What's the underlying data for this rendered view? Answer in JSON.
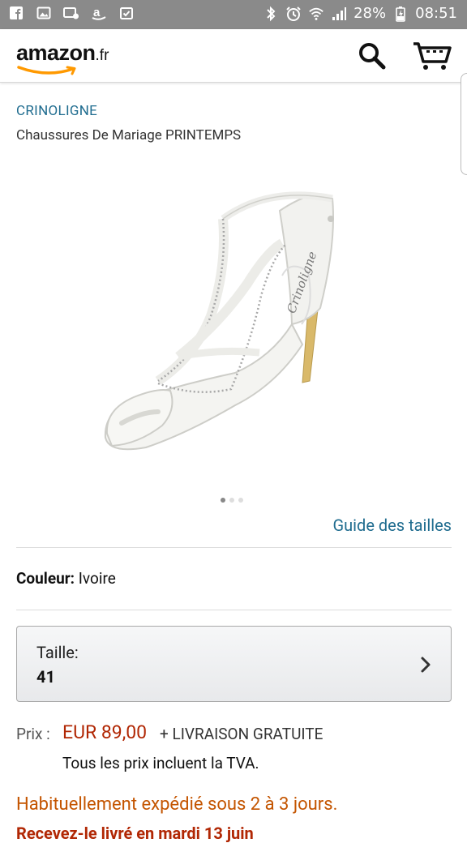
{
  "status_bar": {
    "icons_left": [
      "facebook-icon",
      "gallery-icon",
      "photo-notification-icon",
      "amazon-app-icon",
      "clipboard-check-icon"
    ],
    "battery": "28%",
    "time": "08:51"
  },
  "header": {
    "logo_text": "amazon",
    "logo_tld": ".fr",
    "accent_color": "#ff9900"
  },
  "product": {
    "brand": "CRINOLIGNE",
    "title": "Chaussures De Mariage PRINTEMPS",
    "image_label": "white-bridal-sandal-image",
    "image_count": 3,
    "active_image_index": 0,
    "size_guide_label": "Guide des tailles"
  },
  "color": {
    "label": "Couleur:",
    "value": "Ivoire"
  },
  "size": {
    "label": "Taille:",
    "value": "41"
  },
  "price": {
    "label": "Prix :",
    "value": "EUR 89,00",
    "shipping": "+ LIVRAISON GRATUITE",
    "vat_note": "Tous les prix incluent la TVA."
  },
  "availability": {
    "text": "Habituellement expédié sous 2 à 3 jours.",
    "cutoff_text": "Recevez-le livré en mardi 13 juin"
  },
  "colors": {
    "link": "#1f6c8f",
    "price": "#b12704",
    "availability": "#c45500"
  }
}
